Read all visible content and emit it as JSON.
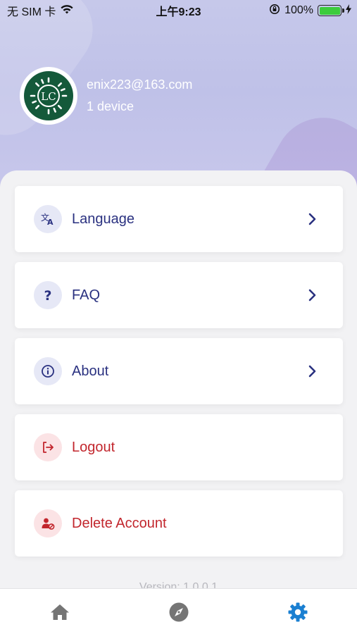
{
  "status_bar": {
    "carrier": "无 SIM 卡",
    "time": "上午9:23",
    "battery_percent": "100%",
    "battery_level": 1.0
  },
  "profile": {
    "email": "enix223@163.com",
    "devices": "1 device",
    "avatar_text": "LC"
  },
  "menu": {
    "language": {
      "label": "Language",
      "icon": "translate-icon"
    },
    "faq": {
      "label": "FAQ",
      "icon": "question-mark-icon"
    },
    "about": {
      "label": "About",
      "icon": "info-icon"
    },
    "logout": {
      "label": "Logout",
      "icon": "logout-icon"
    },
    "delete_account": {
      "label": "Delete Account",
      "icon": "user-block-icon"
    }
  },
  "version": "Version: 1.0.0.1",
  "tabbar": {
    "items": [
      {
        "icon": "home-icon",
        "active": false
      },
      {
        "icon": "compass-icon",
        "active": false
      },
      {
        "icon": "gear-icon",
        "active": true
      }
    ]
  },
  "colors": {
    "accent_blue": "#2a3180",
    "danger_red": "#c2262d",
    "active_tab": "#1a7fd1",
    "inactive_tab": "#757575",
    "header_gradient": "#c3c5ea"
  }
}
